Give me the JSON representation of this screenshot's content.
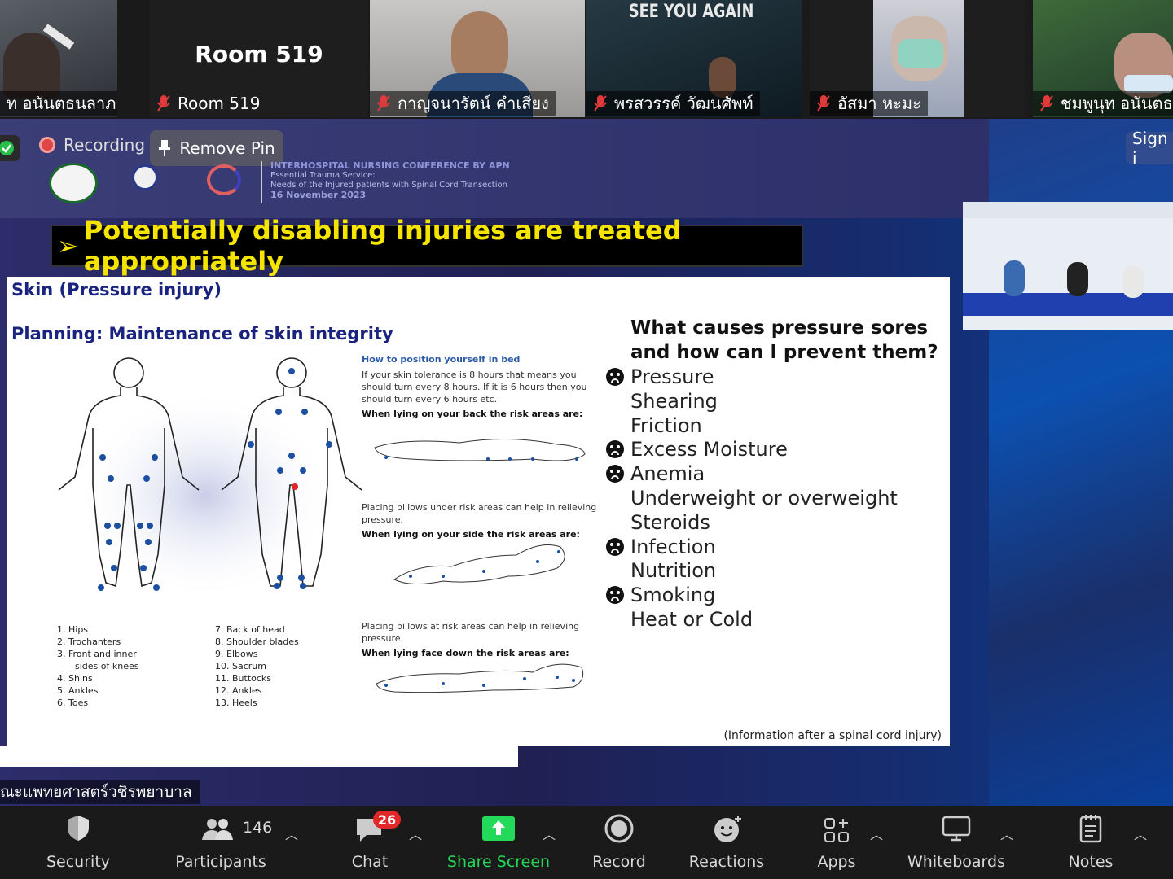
{
  "participants": [
    {
      "name": "ท อนันตธนลาภา"
    },
    {
      "name": "Room 519",
      "tile_title": "Room 519"
    },
    {
      "name": "กาญจนารัตน์ คำเสียง"
    },
    {
      "name": "พรสวรรค์ วัฒนศัพท์"
    },
    {
      "name": "อัสมา หะมะ"
    },
    {
      "name": "ชมพูนุท อนันตธน"
    }
  ],
  "tile_texts": {
    "see_you_again": "SEE YOU AGAIN"
  },
  "share": {
    "recording_label": "Recording",
    "remove_pin_label": "Remove Pin",
    "sign_in_label": "Sign i",
    "conference": {
      "title": "INTERHOSPITAL NURSING CONFERENCE BY APN",
      "line1": "Essential Trauma Service:",
      "line2": "Needs of the Injured patients with Spinal Cord Transection",
      "date": "16 November 2023"
    },
    "speaker_name": "ณะแพทยศาสตร์วชิรพยาบาล"
  },
  "slide": {
    "heading": "Potentially disabling injuries are treated appropriately",
    "subheading": "Skin (Pressure injury)",
    "planning": "Planning: Maintenance of skin integrity",
    "list_left": [
      "1.  Hips",
      "2.  Trochanters",
      "3.  Front and inner",
      "     sides of knees",
      "4.  Shins",
      "5.  Ankles",
      "6.  Toes"
    ],
    "list_right": [
      "7.   Back of head",
      "8.   Shoulder blades",
      "9.   Elbows",
      "10.  Sacrum",
      "11.  Buttocks",
      "12.  Ankles",
      "13.  Heels"
    ],
    "position_title": "How to position yourself in bed",
    "position_text": "If your skin tolerance is 8 hours that means you should turn every 8 hours.  If it is 6 hours then you should turn every 6 hours etc.",
    "back_label": "When lying on your back the risk areas are:",
    "pillows_text_1": "Placing pillows under risk areas can help in relieving pressure.",
    "side_label": "When lying on your side the risk areas are:",
    "pillows_text_2": "Placing pillows at risk areas can help in relieving pressure.",
    "face_label": "When lying face down the risk areas are:",
    "question_line1": "What causes pressure sores",
    "question_line2": "and how can I prevent them?",
    "causes": [
      {
        "text": "Pressure",
        "frown": true
      },
      {
        "text": "Shearing",
        "frown": false
      },
      {
        "text": "Friction",
        "frown": false
      },
      {
        "text": "Excess Moisture",
        "frown": true
      },
      {
        "text": "Anemia",
        "frown": true
      },
      {
        "text": "Underweight or overweight",
        "frown": false
      },
      {
        "text": "Steroids",
        "frown": false
      },
      {
        "text": "Infection",
        "frown": true
      },
      {
        "text": "Nutrition",
        "frown": false
      },
      {
        "text": "Smoking",
        "frown": true
      },
      {
        "text": "Heat or Cold",
        "frown": false
      }
    ],
    "note": "(Information after a spinal cord injury)"
  },
  "toolbar": {
    "security": "Security",
    "participants": "Participants",
    "participant_count": "146",
    "chat": "Chat",
    "chat_badge": "26",
    "share_screen": "Share Screen",
    "record": "Record",
    "reactions": "Reactions",
    "apps": "Apps",
    "whiteboards": "Whiteboards",
    "notes": "Notes"
  },
  "colors": {
    "share_green": "#23d959",
    "heading_yellow": "#f5e400",
    "badge_red": "#e02828"
  }
}
